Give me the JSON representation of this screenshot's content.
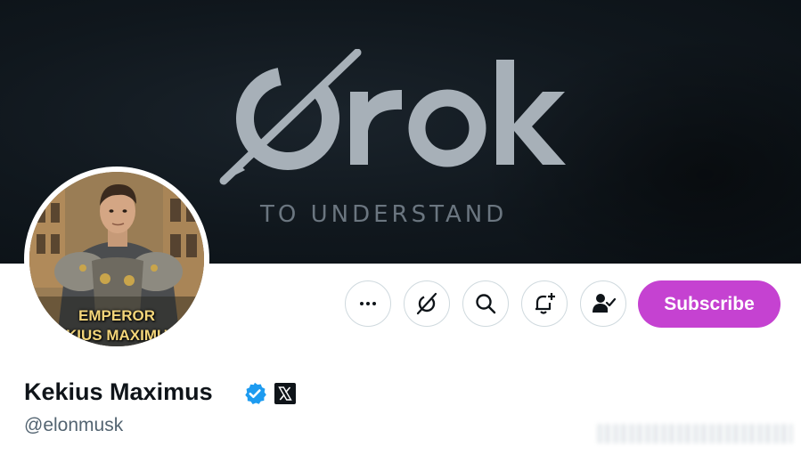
{
  "banner": {
    "logo_text": "Grok",
    "tagline": "TO UNDERSTAND"
  },
  "avatar": {
    "caption_line1": "EMPEROR",
    "caption_line2": "KEKIUS MAXIMUS"
  },
  "profile": {
    "display_name": "Kekius Maximus",
    "handle": "@elonmusk",
    "verified": true,
    "affiliate_badge": "x-logo-icon"
  },
  "actions": {
    "more_icon": "more-icon",
    "grok_icon": "grok-icon",
    "search_icon": "search-icon",
    "notify_icon": "bell-plus-icon",
    "following_icon": "person-check-icon",
    "subscribe_label": "Subscribe"
  },
  "colors": {
    "subscribe": "#c542d1",
    "verified": "#1d9bf0",
    "handle": "#536471",
    "banner": "#10171d"
  }
}
